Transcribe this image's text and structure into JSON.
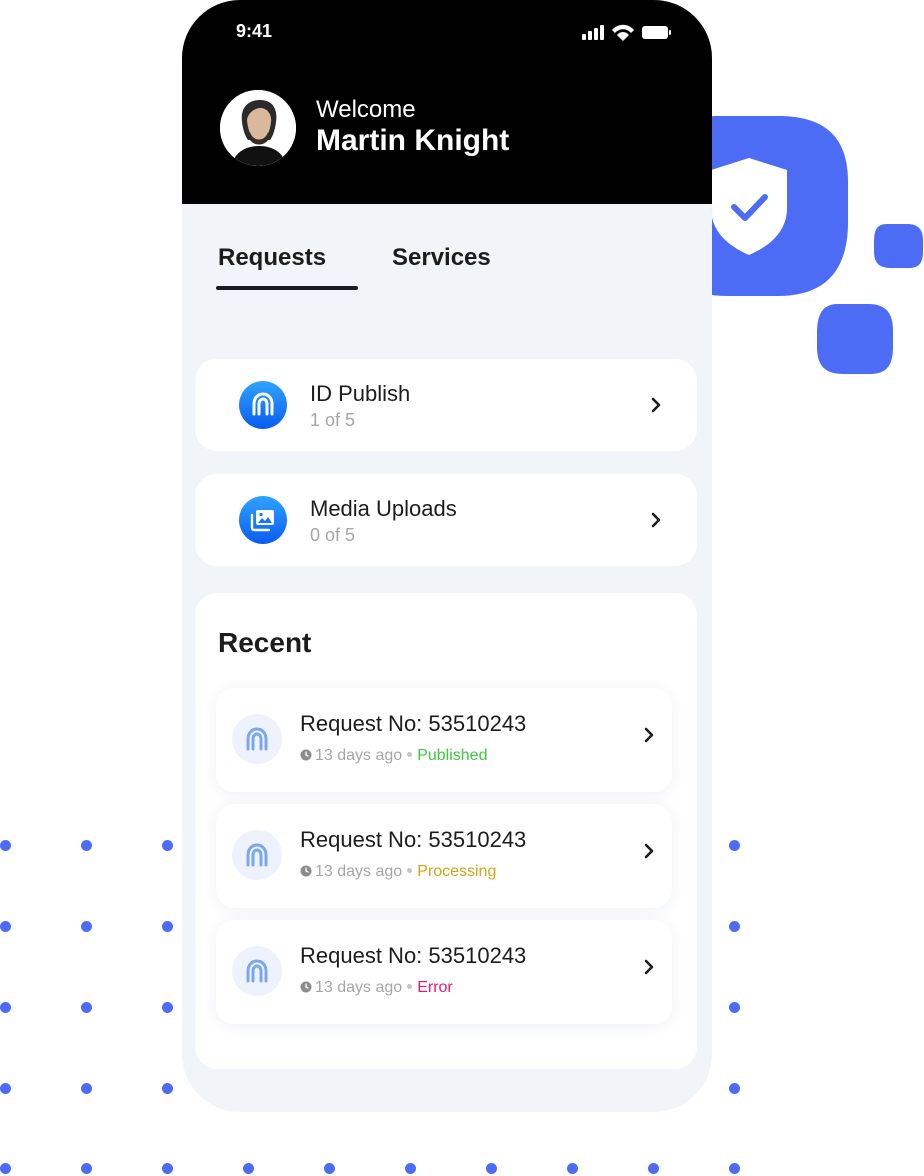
{
  "status_bar": {
    "time": "9:41"
  },
  "header": {
    "greeting": "Welcome",
    "user_name": "Martin Knight"
  },
  "tabs": [
    {
      "label": "Requests",
      "active": true
    },
    {
      "label": "Services",
      "active": false
    }
  ],
  "cards": [
    {
      "title": "ID Publish",
      "subtitle": "1 of 5",
      "icon": "fingerprint-icon"
    },
    {
      "title": "Media Uploads",
      "subtitle": "0 of 5",
      "icon": "media-gallery-icon"
    }
  ],
  "recent": {
    "title": "Recent",
    "items": [
      {
        "title": "Request No: 53510243",
        "time": "13 days ago",
        "status": "Published",
        "status_color": "#3ec83e"
      },
      {
        "title": "Request No: 53510243",
        "time": "13 days ago",
        "status": "Processing",
        "status_color": "#d4a418"
      },
      {
        "title": "Request No: 53510243",
        "time": "13 days ago",
        "status": "Error",
        "status_color": "#e8197d"
      }
    ]
  },
  "colors": {
    "accent": "#4d6cf5",
    "header_bg": "#000000",
    "screen_bg": "#f1f4f9",
    "icon_gradient_top": "#2fa3ff",
    "icon_gradient_bottom": "#0a5cf0"
  }
}
